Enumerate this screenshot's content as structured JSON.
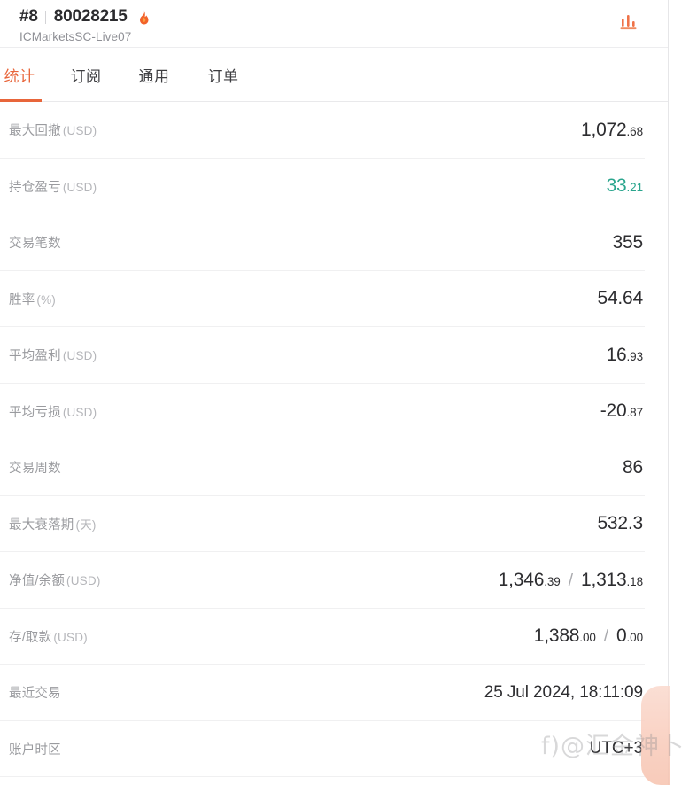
{
  "header": {
    "rank": "#8",
    "account_number": "80028215",
    "broker": "ICMarketsSC-Live07",
    "flame_icon": "flame-icon",
    "chart_icon": "bar-chart-icon"
  },
  "tabs": [
    {
      "label": "统计",
      "active": true
    },
    {
      "label": "订阅",
      "active": false
    },
    {
      "label": "通用",
      "active": false
    },
    {
      "label": "订单",
      "active": false
    }
  ],
  "stats": [
    {
      "label": "最大回撤",
      "unit": "(USD)",
      "int": "1,072",
      "dec": ".68",
      "type": "split",
      "tone": "default"
    },
    {
      "label": "持仓盈亏",
      "unit": "(USD)",
      "int": "33",
      "dec": ".21",
      "type": "split",
      "tone": "positive"
    },
    {
      "label": "交易笔数",
      "unit": "",
      "value": "355",
      "type": "plain",
      "tone": "default"
    },
    {
      "label": "胜率",
      "unit": "(%)",
      "value": "54.64",
      "type": "plain",
      "tone": "default"
    },
    {
      "label": "平均盈利",
      "unit": "(USD)",
      "int": "16",
      "dec": ".93",
      "type": "split",
      "tone": "default"
    },
    {
      "label": "平均亏损",
      "unit": "(USD)",
      "int": "-20",
      "dec": ".87",
      "type": "split",
      "tone": "default"
    },
    {
      "label": "交易周数",
      "unit": "",
      "value": "86",
      "type": "plain",
      "tone": "default"
    },
    {
      "label": "最大衰落期",
      "unit": "(天)",
      "value": "532.3",
      "type": "plain",
      "tone": "default"
    },
    {
      "label": "净值/余额",
      "unit": "(USD)",
      "int": "1,346",
      "dec": ".39",
      "int2": "1,313",
      "dec2": ".18",
      "separator": "/",
      "type": "dual",
      "tone": "default"
    },
    {
      "label": "存/取款",
      "unit": "(USD)",
      "int": "1,388",
      "dec": ".00",
      "int2": "0",
      "dec2": ".00",
      "separator": "/",
      "type": "dual",
      "tone": "default"
    },
    {
      "label": "最近交易",
      "unit": "",
      "value": "25 Jul 2024, 18:11:09",
      "type": "date",
      "tone": "default"
    },
    {
      "label": "账户时区",
      "unit": "",
      "value": "UTC+3",
      "type": "date",
      "tone": "default"
    }
  ],
  "watermark": {
    "text": "f)@汇金神卜"
  },
  "colors": {
    "accent": "#e8653a",
    "positive": "#2aa58d",
    "text": "#2d2d30",
    "label": "#9a9b9f",
    "divider": "#f0f0f1"
  }
}
